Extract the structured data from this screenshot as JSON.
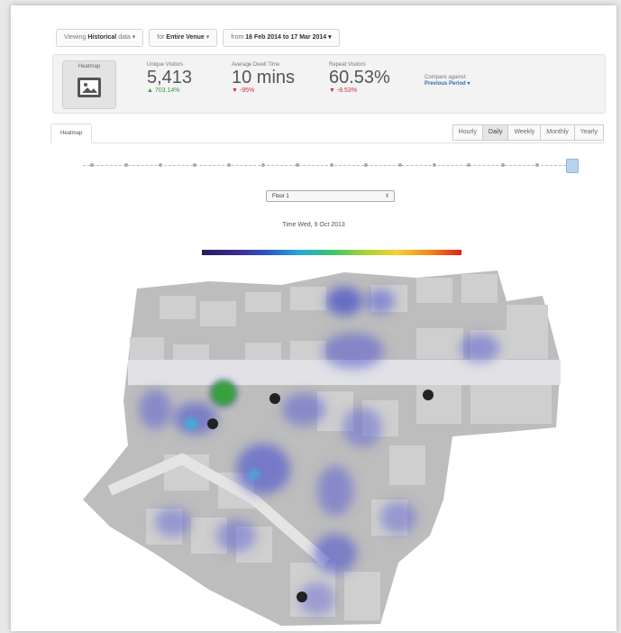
{
  "filters": [
    {
      "prefix": "Viewing",
      "value": "Historical",
      "suffix": "data ▾"
    },
    {
      "prefix": "for",
      "value": "Entire Venue",
      "suffix": "▾"
    },
    {
      "prefix": "from",
      "value": "16 Feb 2014",
      "suffix": "to 17 Mar 2014 ▾"
    }
  ],
  "stats_panel": {
    "heatmap_label": "Heatmap",
    "metrics": [
      {
        "title": "Unique Visitors",
        "value": "5,413",
        "delta": "▲ 703.14%",
        "delta_color": "#3a9a3a"
      },
      {
        "title": "Average Dwell Time",
        "value": "10 mins",
        "delta": "▼ -95%",
        "delta_color": "#d0303a"
      },
      {
        "title": "Repeat Visitors",
        "value": "60.53%",
        "delta": "▼ -8.53%",
        "delta_color": "#d0303a"
      }
    ],
    "compare_label": "Compare against",
    "compare_value": "Previous Period ▾"
  },
  "tabs": {
    "heatmap_tab": "Heatmap",
    "periods": [
      "Hourly",
      "Daily",
      "Weekly",
      "Monthly",
      "Yearly"
    ],
    "active_period": "Daily"
  },
  "floor_select": {
    "value": "Floor 1",
    "arrow": "⇕"
  },
  "time_label": "Time  Wed, 9 Oct 2013",
  "map_icons": [
    "toilet-icon",
    "wheelchair-icon",
    "info-icon",
    "info-icon",
    "info-icon"
  ]
}
